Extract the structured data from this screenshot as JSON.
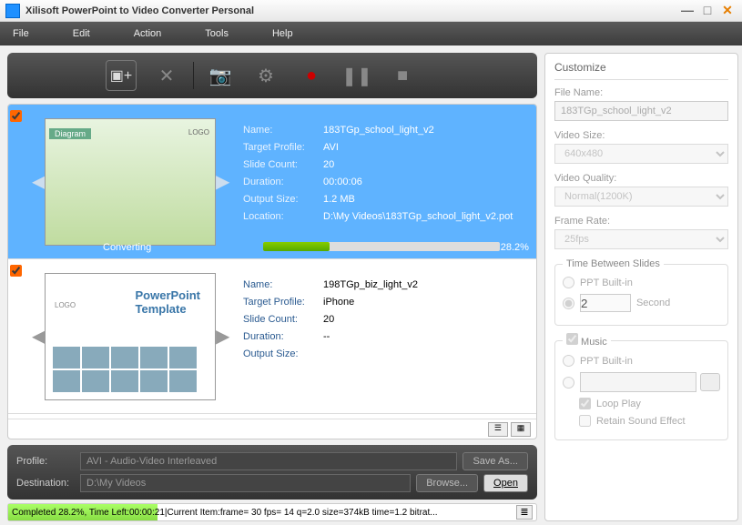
{
  "window": {
    "title": "Xilisoft PowerPoint to Video Converter Personal"
  },
  "menu": {
    "file": "File",
    "edit": "Edit",
    "action": "Action",
    "tools": "Tools",
    "help": "Help"
  },
  "items": [
    {
      "selected": true,
      "name_label": "Name:",
      "name": "183TGp_school_light_v2",
      "profile_label": "Target Profile:",
      "profile": "AVI",
      "count_label": "Slide Count:",
      "count": "20",
      "duration_label": "Duration:",
      "duration": "00:00:06",
      "size_label": "Output Size:",
      "size": "1.2 MB",
      "location_label": "Location:",
      "location": "D:\\My Videos\\183TGp_school_light_v2.pot",
      "status": "Converting",
      "percent": "28.2%",
      "percent_num": 28.2
    },
    {
      "selected": false,
      "name_label": "Name:",
      "name": "198TGp_biz_light_v2",
      "profile_label": "Target Profile:",
      "profile": "iPhone",
      "count_label": "Slide Count:",
      "count": "20",
      "duration_label": "Duration:",
      "duration": "--",
      "size_label": "Output Size:",
      "size": ""
    }
  ],
  "profile": {
    "label": "Profile:",
    "value": "AVI - Audio-Video Interleaved",
    "saveas": "Save As...",
    "dest_label": "Destination:",
    "dest_value": "D:\\My Videos",
    "browse": "Browse...",
    "open": "Open"
  },
  "status": {
    "text": "Completed 28.2%, Time Left:00:00:21|Current Item:frame= 30 fps= 14 q=2.0 size=374kB time=1.2 bitrat...",
    "percent": 28.2
  },
  "customize": {
    "title": "Customize",
    "filename_label": "File Name:",
    "filename": "183TGp_school_light_v2",
    "videosize_label": "Video Size:",
    "videosize": "640x480",
    "quality_label": "Video Quality:",
    "quality": "Normal(1200K)",
    "framerate_label": "Frame Rate:",
    "framerate": "25fps",
    "tbs": {
      "legend": "Time Between Slides",
      "builtin": "PPT Built-in",
      "seconds_value": "2",
      "seconds_label": "Second"
    },
    "music": {
      "legend": "Music",
      "builtin": "PPT Built-in",
      "loop": "Loop Play",
      "retain": "Retain Sound Effect"
    }
  }
}
